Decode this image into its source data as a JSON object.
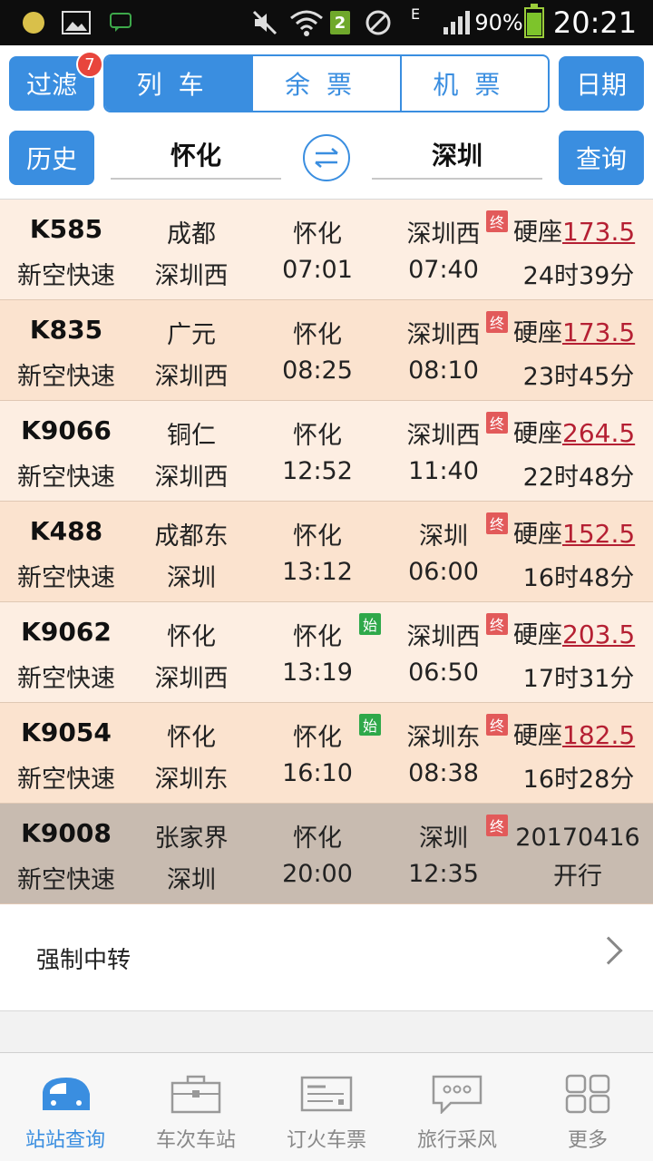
{
  "status_bar": {
    "wifi_badge": "2",
    "network": "E",
    "battery": "90%",
    "time": "20:21"
  },
  "topbar": {
    "filter_label": "过滤",
    "filter_badge": "7",
    "tabs": [
      {
        "label": "列车",
        "active": true
      },
      {
        "label": "余票",
        "active": false
      },
      {
        "label": "机票",
        "active": false
      }
    ],
    "date_label": "日期",
    "history_label": "历史",
    "from_station": "怀化",
    "to_station": "深圳",
    "search_label": "查询",
    "swap_icon": "swap-arrows-icon"
  },
  "trains": [
    {
      "no": "K585",
      "type": "新空快速",
      "origin": "成都",
      "terminal": "深圳西",
      "dep_station": "怀化",
      "dep_time": "07:01",
      "arr_station": "深圳西",
      "arr_time": "07:40",
      "seat": "硬座",
      "price": "173.5",
      "duration": "24时39分",
      "start_tag": "",
      "end_tag": "终",
      "tone": "light"
    },
    {
      "no": "K835",
      "type": "新空快速",
      "origin": "广元",
      "terminal": "深圳西",
      "dep_station": "怀化",
      "dep_time": "08:25",
      "arr_station": "深圳西",
      "arr_time": "08:10",
      "seat": "硬座",
      "price": "173.5",
      "duration": "23时45分",
      "start_tag": "",
      "end_tag": "终",
      "tone": "dark"
    },
    {
      "no": "K9066",
      "type": "新空快速",
      "origin": "铜仁",
      "terminal": "深圳西",
      "dep_station": "怀化",
      "dep_time": "12:52",
      "arr_station": "深圳西",
      "arr_time": "11:40",
      "seat": "硬座",
      "price": "264.5",
      "duration": "22时48分",
      "start_tag": "",
      "end_tag": "终",
      "tone": "light"
    },
    {
      "no": "K488",
      "type": "新空快速",
      "origin": "成都东",
      "terminal": "深圳",
      "dep_station": "怀化",
      "dep_time": "13:12",
      "arr_station": "深圳",
      "arr_time": "06:00",
      "seat": "硬座",
      "price": "152.5",
      "duration": "16时48分",
      "start_tag": "",
      "end_tag": "终",
      "tone": "dark"
    },
    {
      "no": "K9062",
      "type": "新空快速",
      "origin": "怀化",
      "terminal": "深圳西",
      "dep_station": "怀化",
      "dep_time": "13:19",
      "arr_station": "深圳西",
      "arr_time": "06:50",
      "seat": "硬座",
      "price": "203.5",
      "duration": "17时31分",
      "start_tag": "始",
      "end_tag": "终",
      "tone": "light"
    },
    {
      "no": "K9054",
      "type": "新空快速",
      "origin": "怀化",
      "terminal": "深圳东",
      "dep_station": "怀化",
      "dep_time": "16:10",
      "arr_station": "深圳东",
      "arr_time": "08:38",
      "seat": "硬座",
      "price": "182.5",
      "duration": "16时28分",
      "start_tag": "始",
      "end_tag": "终",
      "tone": "dark"
    },
    {
      "no": "K9008",
      "type": "新空快速",
      "origin": "张家界",
      "terminal": "深圳",
      "dep_station": "怀化",
      "dep_time": "20:00",
      "arr_station": "深圳",
      "arr_time": "12:35",
      "seat": "",
      "price": "",
      "duration": "",
      "sale_date": "20170416",
      "sale_note": "开行",
      "start_tag": "",
      "end_tag": "终",
      "tone": "gray"
    }
  ],
  "transfer": {
    "label": "强制中转",
    "icon": "chevron-right-icon"
  },
  "bottom_nav": [
    {
      "label": "站站查询",
      "icon": "train-front-icon",
      "active": true
    },
    {
      "label": "车次车站",
      "icon": "briefcase-icon",
      "active": false
    },
    {
      "label": "订火车票",
      "icon": "ticket-icon",
      "active": false
    },
    {
      "label": "旅行采风",
      "icon": "chat-bubble-icon",
      "active": false
    },
    {
      "label": "更多",
      "icon": "grid-icon",
      "active": false
    }
  ],
  "colors": {
    "accent": "#3a8ee0",
    "price": "#b52033",
    "end_tag": "#e25a5a",
    "start_tag": "#2fa84a"
  }
}
